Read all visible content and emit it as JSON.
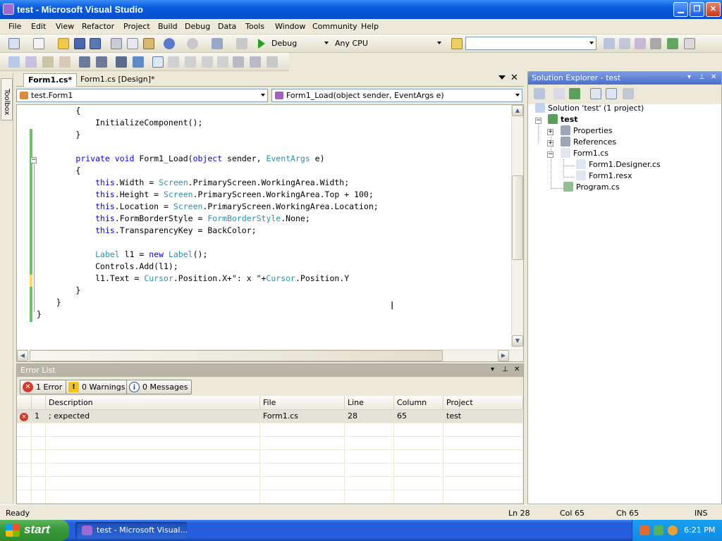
{
  "window": {
    "title": "test - Microsoft Visual Studio",
    "btn_min": "▁",
    "btn_max": "❐",
    "btn_close": "✕"
  },
  "menu": [
    "File",
    "Edit",
    "View",
    "Refactor",
    "Project",
    "Build",
    "Debug",
    "Data",
    "Tools",
    "Window",
    "Community",
    "Help"
  ],
  "toolbar": {
    "config": "Debug",
    "platform": "Any CPU",
    "find_combo": ""
  },
  "toolbox": {
    "label": "Toolbox"
  },
  "editor": {
    "tabs": [
      "Form1.cs*",
      "Form1.cs [Design]*"
    ],
    "class_combo": "test.Form1",
    "member_combo": "Form1_Load(object sender, EventArgs e)",
    "code_lines": [
      [
        [
          "",
          "        {"
        ]
      ],
      [
        [
          "",
          "            InitializeComponent();"
        ]
      ],
      [
        [
          "",
          "        }"
        ]
      ],
      [
        [
          "",
          ""
        ]
      ],
      [
        [
          "",
          "        "
        ],
        [
          "kw",
          "private void"
        ],
        [
          "",
          " Form1_Load("
        ],
        [
          "kw",
          "object"
        ],
        [
          "",
          " sender, "
        ],
        [
          "ty",
          "EventArgs"
        ],
        [
          "",
          " e)"
        ]
      ],
      [
        [
          "",
          "        {"
        ]
      ],
      [
        [
          "",
          "            "
        ],
        [
          "kw",
          "this"
        ],
        [
          "",
          ".Width = "
        ],
        [
          "ty",
          "Screen"
        ],
        [
          "",
          ".PrimaryScreen.WorkingArea.Width;"
        ]
      ],
      [
        [
          "",
          "            "
        ],
        [
          "kw",
          "this"
        ],
        [
          "",
          ".Height = "
        ],
        [
          "ty",
          "Screen"
        ],
        [
          "",
          ".PrimaryScreen.WorkingArea.Top + 100;"
        ]
      ],
      [
        [
          "",
          "            "
        ],
        [
          "kw",
          "this"
        ],
        [
          "",
          ".Location = "
        ],
        [
          "ty",
          "Screen"
        ],
        [
          "",
          ".PrimaryScreen.WorkingArea.Location;"
        ]
      ],
      [
        [
          "",
          "            "
        ],
        [
          "kw",
          "this"
        ],
        [
          "",
          ".FormBorderStyle = "
        ],
        [
          "ty",
          "FormBorderStyle"
        ],
        [
          "",
          ".None;"
        ]
      ],
      [
        [
          "",
          "            "
        ],
        [
          "kw",
          "this"
        ],
        [
          "",
          ".TransparencyKey = BackColor;"
        ]
      ],
      [
        [
          "",
          ""
        ]
      ],
      [
        [
          "",
          "            "
        ],
        [
          "ty",
          "Label"
        ],
        [
          "",
          " l1 = "
        ],
        [
          "kw",
          "new"
        ],
        [
          "",
          " "
        ],
        [
          "ty",
          "Label"
        ],
        [
          "",
          "();"
        ]
      ],
      [
        [
          "",
          "            Controls.Add(l1);"
        ]
      ],
      [
        [
          "",
          "            l1.Text = "
        ],
        [
          "ty",
          "Cursor"
        ],
        [
          "",
          ".Position.X+\": x \"+"
        ],
        [
          "ty",
          "Cursor"
        ],
        [
          "",
          ".Position.Y"
        ]
      ],
      [
        [
          "",
          "        }"
        ]
      ],
      [
        [
          "",
          "    }"
        ]
      ],
      [
        [
          "",
          "}"
        ]
      ]
    ]
  },
  "error_list": {
    "title": "Error List",
    "errors_btn": "1 Error",
    "warnings_btn": "0 Warnings",
    "messages_btn": "0 Messages",
    "columns": [
      "",
      "Description",
      "File",
      "Line",
      "Column",
      "Project"
    ],
    "rows": [
      {
        "index": "1",
        "description": "; expected",
        "file": "Form1.cs",
        "line": "28",
        "column": "65",
        "project": "test"
      }
    ]
  },
  "solution_explorer": {
    "title": "Solution Explorer - test",
    "nodes": [
      {
        "label": "Solution 'test' (1 project)",
        "icon_color": "#c0d4f0"
      },
      {
        "label": "test",
        "icon_color": "#5aa05a",
        "bold": true
      },
      {
        "label": "Properties",
        "icon_color": "#9aa5b8"
      },
      {
        "label": "References",
        "icon_color": "#9aa5b8"
      },
      {
        "label": "Form1.cs",
        "icon_color": "#dfe6f2"
      },
      {
        "label": "Form1.Designer.cs",
        "icon_color": "#dfe6f2"
      },
      {
        "label": "Form1.resx",
        "icon_color": "#dfe6f2"
      },
      {
        "label": "Program.cs",
        "icon_color": "#8fc08f"
      }
    ]
  },
  "statusbar": {
    "state": "Ready",
    "ln": "Ln 28",
    "col": "Col 65",
    "ch": "Ch 65",
    "mode": "INS"
  },
  "taskbar": {
    "start": "start",
    "item": "test - Microsoft Visual...",
    "clock": "6:21 PM"
  },
  "colors": {
    "keyword": "#0000ff",
    "type": "#2b91af",
    "xp_blue": "#0a5ce0",
    "start_green": "#3b9c3b"
  }
}
